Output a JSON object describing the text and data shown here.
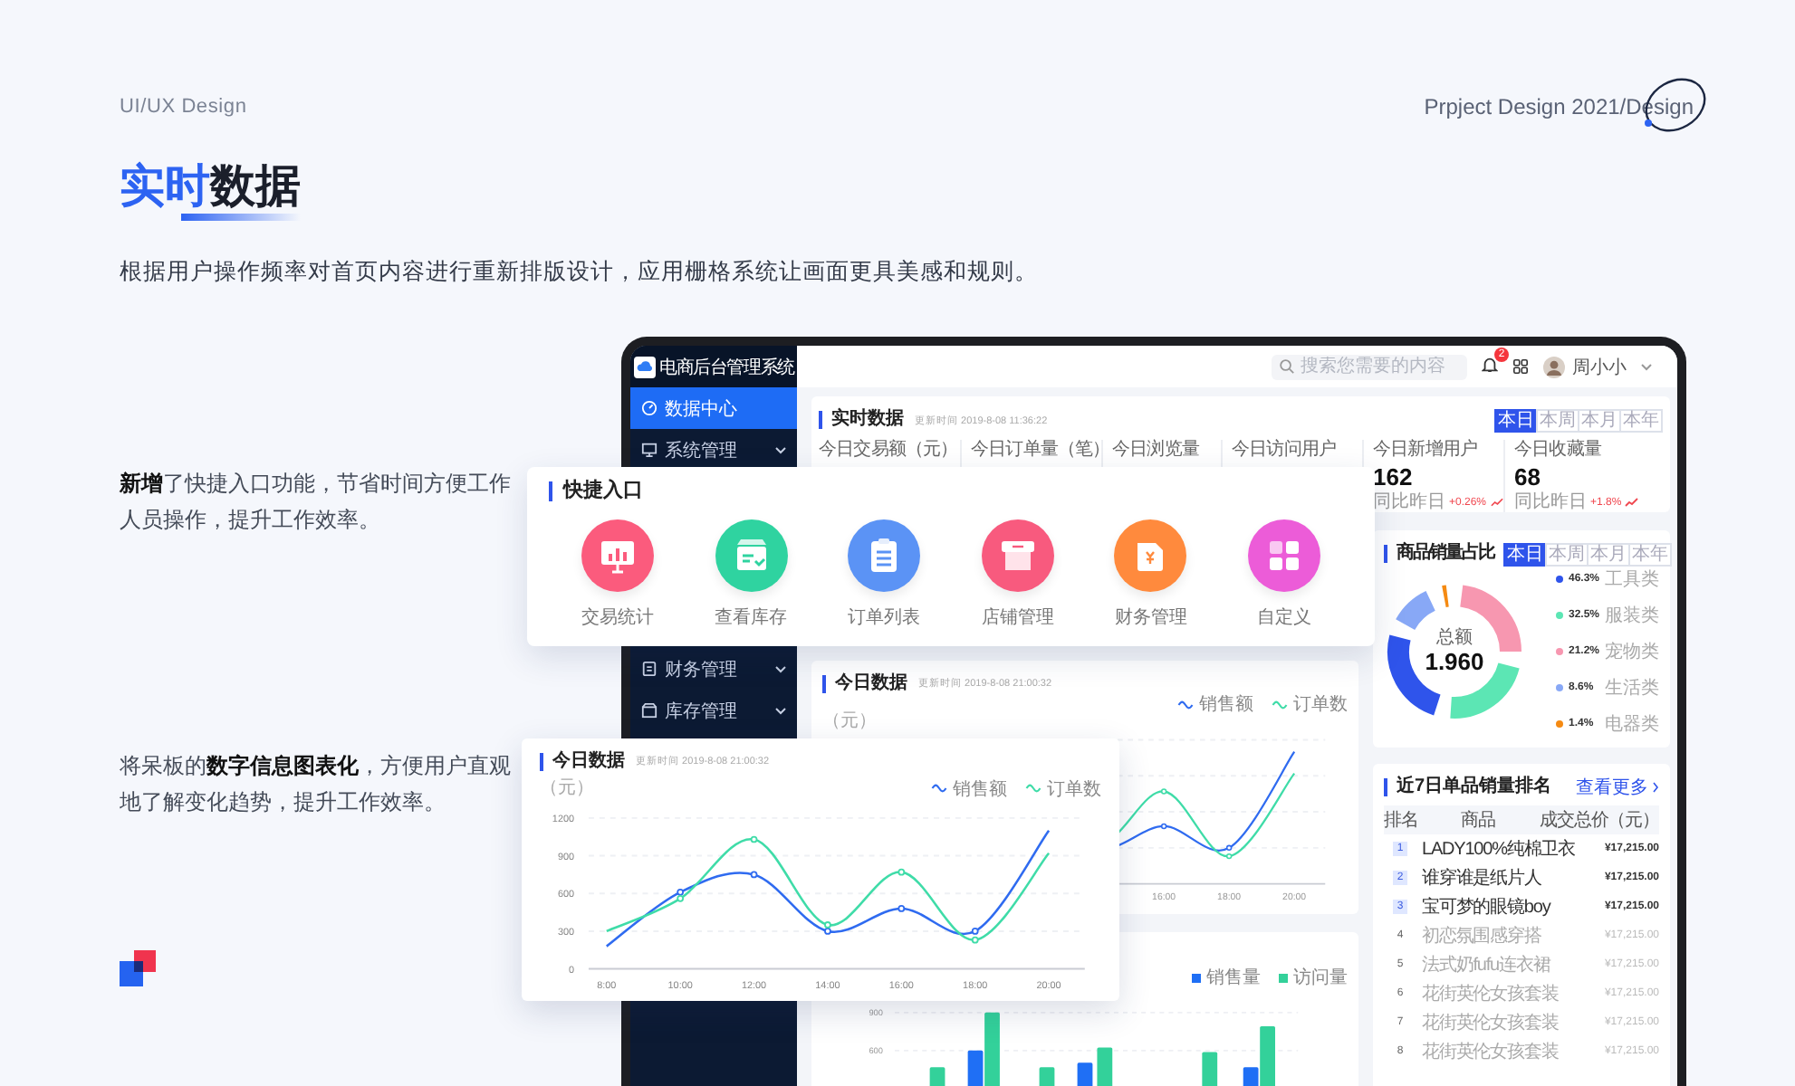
{
  "slide": {
    "overline": "UI/UX Design",
    "project_label": "Prpject Design 2021/Design",
    "title_accent": "实时",
    "title_rest": "数据",
    "intro": "根据用户操作频率对首页内容进行重新排版设计，应用栅格系统让画面更具美感和规则。",
    "notes": [
      {
        "text": "**新增**了快捷入口功能，节省时间方便工作人员操作，提升工作效率。"
      },
      {
        "text": "将呆板的**数字信息图表化**，方便用户直观地了解变化趋势，提升工作效率。"
      }
    ]
  },
  "app": {
    "brand": "电商后台管理系统",
    "sidebar": {
      "items": [
        {
          "label": "数据中心",
          "kind": "gauge",
          "selected": true,
          "expandable": false
        },
        {
          "label": "系统管理",
          "kind": "monitor",
          "selected": false,
          "expandable": true
        }
      ],
      "lower_items": [
        {
          "label": "财务管理",
          "kind": "wallet",
          "selected": false,
          "expandable": true
        },
        {
          "label": "库存管理",
          "kind": "box",
          "selected": false,
          "expandable": true
        }
      ]
    },
    "topbar": {
      "search": {
        "placeholder": "搜索您需要的内容"
      },
      "notifications": "2",
      "user": "周小小"
    },
    "realtime": {
      "title": "实时数据",
      "updated": "更新时间 2019-8-08 11:36:22",
      "periods": [
        {
          "label": "本日",
          "selected": true
        },
        {
          "label": "本周",
          "selected": false
        },
        {
          "label": "本月",
          "selected": false
        },
        {
          "label": "本年",
          "selected": false
        }
      ],
      "stats": [
        {
          "label": "今日交易额（元）"
        },
        {
          "label": "今日订单量（笔）"
        },
        {
          "label": "今日浏览量"
        },
        {
          "label": "今日访问用户"
        },
        {
          "label": "今日新增用户",
          "value": "162",
          "compare": "同比昨日",
          "change": "+0.26%"
        },
        {
          "label": "今日收藏量",
          "value": "68",
          "compare": "同比昨日",
          "change": "+1.8%"
        }
      ]
    },
    "today_back": {
      "title": "今日数据",
      "updated": "更新时间 2019-8-08 21:00:32",
      "unit": "（元）",
      "legend": [
        {
          "name": "销售额",
          "color": "#2f6bf0"
        },
        {
          "name": "订单数",
          "color": "#3fdca8"
        }
      ],
      "x_labels": [
        "16:00",
        "18:00",
        "20:00"
      ]
    },
    "bars": {
      "legend": [
        {
          "name": "销售量",
          "color": "#1f6ff5"
        },
        {
          "name": "访问量",
          "color": "#33d19a"
        }
      ],
      "y_labels": [
        "900",
        "600"
      ]
    },
    "category_share": {
      "title": "商品销量占比",
      "periods": [
        {
          "label": "本日",
          "selected": true
        },
        {
          "label": "本周",
          "selected": false
        },
        {
          "label": "本月",
          "selected": false
        },
        {
          "label": "本年",
          "selected": false
        }
      ],
      "total_label": "总额",
      "total": "1.960",
      "legend": [
        {
          "percent": "46.3%",
          "name": "工具类",
          "color": "#2f54eb"
        },
        {
          "percent": "32.5%",
          "name": "服装类",
          "color": "#5ce6b4"
        },
        {
          "percent": "21.2%",
          "name": "宠物类",
          "color": "#f797b0"
        },
        {
          "percent": "8.6%",
          "name": "生活类",
          "color": "#88a8f6"
        },
        {
          "percent": "1.4%",
          "name": "电器类",
          "color": "#f58a12"
        }
      ]
    },
    "ranking": {
      "title": "近7日单品销量排名",
      "more": "查看更多",
      "columns": [
        "排名",
        "商品",
        "成交总价（元）"
      ],
      "rows": [
        {
          "rank": "1",
          "name": "LADY100%纯棉卫衣",
          "price": "¥17,215.00",
          "highlight": true
        },
        {
          "rank": "2",
          "name": "谁穿谁是纸片人",
          "price": "¥17,215.00",
          "highlight": true
        },
        {
          "rank": "3",
          "name": "宝可梦的眼镜boy",
          "price": "¥17,215.00",
          "highlight": true
        },
        {
          "rank": "4",
          "name": "初恋氛围感穿搭",
          "price": "¥17,215.00",
          "highlight": false
        },
        {
          "rank": "5",
          "name": "法式奶fufu连衣裙",
          "price": "¥17,215.00",
          "highlight": false
        },
        {
          "rank": "6",
          "name": "花街英伦女孩套装",
          "price": "¥17,215.00",
          "highlight": false
        },
        {
          "rank": "7",
          "name": "花街英伦女孩套装",
          "price": "¥17,215.00",
          "highlight": false
        },
        {
          "rank": "8",
          "name": "花街英伦女孩套装",
          "price": "¥17,215.00",
          "highlight": false
        }
      ]
    }
  },
  "quick_entry": {
    "title": "快捷入口",
    "items": [
      {
        "label": "交易统计",
        "kind": "chart",
        "color": "#fb5b7d"
      },
      {
        "label": "查看库存",
        "kind": "box",
        "color": "#2fd3a0"
      },
      {
        "label": "订单列表",
        "kind": "clipboard",
        "color": "#5b93f5"
      },
      {
        "label": "店铺管理",
        "kind": "shop",
        "color": "#f85a7e"
      },
      {
        "label": "财务管理",
        "kind": "wallet",
        "color": "#ff8a3d"
      },
      {
        "label": "自定义",
        "kind": "grid",
        "color": "#ec5cd8"
      }
    ]
  },
  "today_chart": {
    "title": "今日数据",
    "updated": "更新时间 2019-8-08 21:00:32",
    "unit": "（元）",
    "chart_data": {
      "type": "line",
      "grid": true,
      "x": [
        "8:00",
        "10:00",
        "12:00",
        "14:00",
        "16:00",
        "18:00",
        "20:00"
      ],
      "ylim": [
        0,
        1200
      ],
      "yticks": [
        0,
        300,
        600,
        900,
        1200
      ],
      "series": [
        {
          "name": "销售额",
          "color": "#2f6bf0",
          "values": [
            180,
            610,
            750,
            300,
            480,
            300,
            1100
          ]
        },
        {
          "name": "订单数",
          "color": "#3fdca8",
          "values": [
            300,
            560,
            1030,
            350,
            770,
            230,
            920
          ]
        }
      ]
    }
  }
}
